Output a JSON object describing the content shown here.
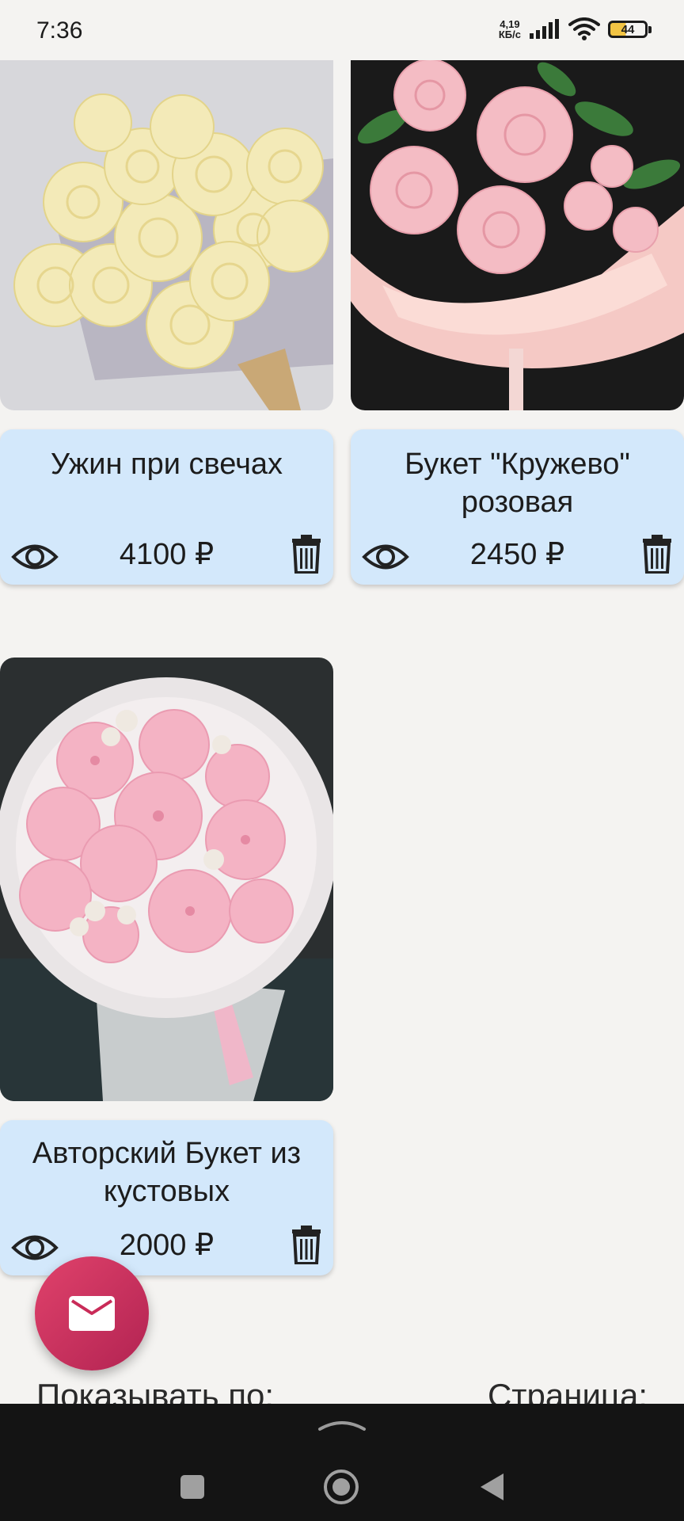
{
  "status_bar": {
    "time": "7:36",
    "net_speed_value": "4,19",
    "net_speed_unit": "КБ/с",
    "battery_level": "44"
  },
  "products": [
    {
      "title": "Ужин при свечах",
      "price": "4100 ₽",
      "view_icon": "eye-icon",
      "delete_icon": "trash-icon"
    },
    {
      "title": "Букет \"Кружево\" розовая",
      "price": "2450 ₽",
      "view_icon": "eye-icon",
      "delete_icon": "trash-icon"
    },
    {
      "title": "Авторский Букет из кустовых",
      "price": "2000 ₽",
      "view_icon": "eye-icon",
      "delete_icon": "trash-icon"
    }
  ],
  "fab": {
    "icon": "mail-icon",
    "color": "#d6335e"
  },
  "pagination": {
    "per_page_label": "Показывать по:",
    "page_label": "Страница:"
  },
  "colors": {
    "card_background": "#d3e8fb",
    "screen_background": "#f4f3f1",
    "nav_bar": "#141414"
  }
}
